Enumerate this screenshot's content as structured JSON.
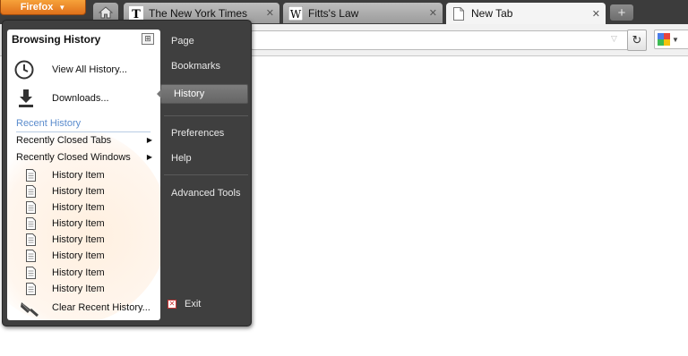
{
  "app_button": {
    "label": "Firefox"
  },
  "tabs": [
    {
      "title": "The New York Times",
      "favicon": "nyt-icon",
      "close": "✕"
    },
    {
      "title": "Fitts's Law",
      "favicon": "wikipedia-icon",
      "close": "✕"
    },
    {
      "title": "New Tab",
      "favicon": "blank-page-icon",
      "close": "✕"
    }
  ],
  "new_tab_button": "+",
  "menu": {
    "left_pane": {
      "title": "Browsing History",
      "view_all": "View All History...",
      "downloads": "Downloads...",
      "recent_heading": "Recent History",
      "recently_closed_tabs": "Recently Closed Tabs",
      "recently_closed_windows": "Recently Closed Windows",
      "history_items": [
        "History Item",
        "History Item",
        "History Item",
        "History Item",
        "History Item",
        "History Item",
        "History Item",
        "History Item"
      ],
      "clear_recent": "Clear Recent History..."
    },
    "right_pane": {
      "page": "Page",
      "bookmarks": "Bookmarks",
      "history": "History",
      "preferences": "Preferences",
      "help": "Help",
      "advanced_tools": "Advanced Tools",
      "exit": "Exit"
    }
  },
  "colors": {
    "firefox_button": "#e8851f",
    "menu_background": "#3f3f3f",
    "section_heading": "#5b8ccd"
  }
}
